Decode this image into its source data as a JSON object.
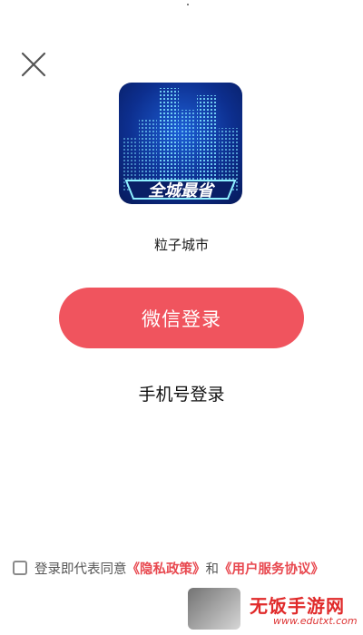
{
  "header": {
    "close_icon": "close-icon"
  },
  "app": {
    "logo_icon": "app-logo-city",
    "logo_text": "全城最省",
    "name": "粒子城市"
  },
  "login": {
    "wechat_label": "微信登录",
    "phone_label": "手机号登录",
    "accent_color": "#f0545e"
  },
  "agreement": {
    "checked": false,
    "prefix": "登录即代表同意",
    "privacy_link": "《隐私政策》",
    "connector": "和",
    "terms_link": "《用户服务协议》",
    "link_color": "#e8484f"
  },
  "watermark": {
    "title": "无饭手游网",
    "url": "www.edutxt.com"
  }
}
